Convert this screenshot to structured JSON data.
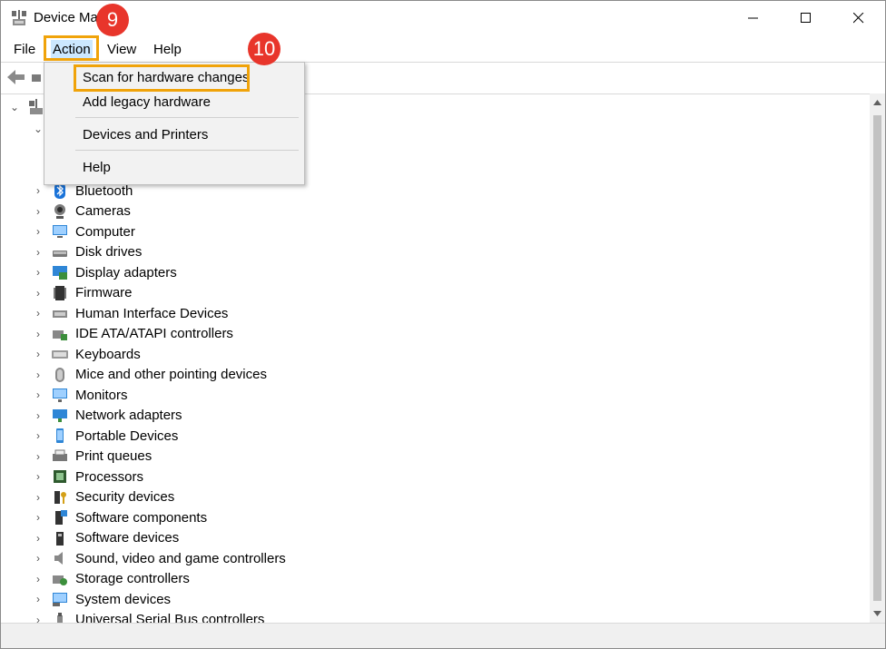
{
  "window": {
    "title": "Device Ma"
  },
  "menubar": {
    "file": "File",
    "action": "Action",
    "view": "View",
    "help": "Help"
  },
  "callouts": {
    "step9": "9",
    "step10": "10"
  },
  "action_menu": {
    "items": [
      "Scan for hardware changes",
      "Add legacy hardware",
      "Devices and Printers",
      "Help"
    ]
  },
  "tree": {
    "categories": [
      {
        "label": "Bluetooth",
        "icon": "bluetooth-icon"
      },
      {
        "label": "Cameras",
        "icon": "camera-icon"
      },
      {
        "label": "Computer",
        "icon": "computer-icon"
      },
      {
        "label": "Disk drives",
        "icon": "disk-drive-icon"
      },
      {
        "label": "Display adapters",
        "icon": "display-adapter-icon"
      },
      {
        "label": "Firmware",
        "icon": "firmware-icon"
      },
      {
        "label": "Human Interface Devices",
        "icon": "hid-icon"
      },
      {
        "label": "IDE ATA/ATAPI controllers",
        "icon": "ide-controller-icon"
      },
      {
        "label": "Keyboards",
        "icon": "keyboard-icon"
      },
      {
        "label": "Mice and other pointing devices",
        "icon": "mouse-icon"
      },
      {
        "label": "Monitors",
        "icon": "monitor-icon"
      },
      {
        "label": "Network adapters",
        "icon": "network-adapter-icon"
      },
      {
        "label": "Portable Devices",
        "icon": "portable-device-icon"
      },
      {
        "label": "Print queues",
        "icon": "printer-icon"
      },
      {
        "label": "Processors",
        "icon": "processor-icon"
      },
      {
        "label": "Security devices",
        "icon": "security-device-icon"
      },
      {
        "label": "Software components",
        "icon": "software-component-icon"
      },
      {
        "label": "Software devices",
        "icon": "software-device-icon"
      },
      {
        "label": "Sound, video and game controllers",
        "icon": "speaker-icon"
      },
      {
        "label": "Storage controllers",
        "icon": "storage-controller-icon"
      },
      {
        "label": "System devices",
        "icon": "system-device-icon"
      },
      {
        "label": "Universal Serial Bus controllers",
        "icon": "usb-icon"
      }
    ]
  },
  "colors": {
    "highlight": "#f0a30a",
    "badge": "#e8352b",
    "accent": "#0078d7"
  }
}
